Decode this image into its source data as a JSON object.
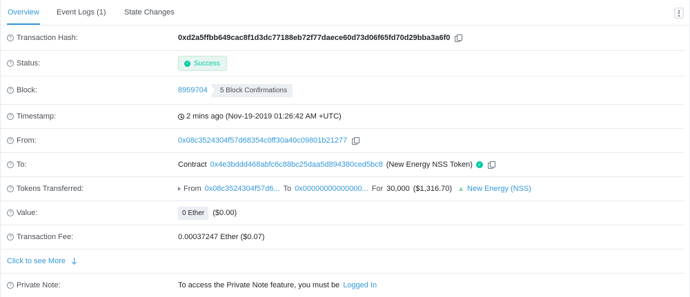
{
  "tabs": [
    {
      "label": "Overview",
      "active": true
    },
    {
      "label": "Event Logs (1)",
      "active": false
    },
    {
      "label": "State Changes",
      "active": false
    }
  ],
  "rows": {
    "tx_hash": {
      "label": "Transaction Hash:",
      "value": "0xd2a5ffbb649cac8f1d3dc77188eb72f77daece60d73d06f65fd70d29bba3a6f0"
    },
    "status": {
      "label": "Status:",
      "value": "Success"
    },
    "block": {
      "label": "Block:",
      "number": "8959704",
      "confirmations": "5 Block Confirmations"
    },
    "timestamp": {
      "label": "Timestamp:",
      "value": "2 mins ago (Nov-19-2019 01:26:42 AM +UTC)"
    },
    "from": {
      "label": "From:",
      "value": "0x08c3524304f57d68354c0ff30a40c09801b21277"
    },
    "to": {
      "label": "To:",
      "prefix": "Contract",
      "address": "0x4e3bddd468abfc6c88bc25daa5d894380ced5bc8",
      "name": "(New Energy NSS Token)"
    },
    "tokens": {
      "label": "Tokens Transferred:",
      "from_label": "From",
      "from_addr": "0x08c3524304f57d6...",
      "to_label": "To",
      "to_addr": "0x00000000000000...",
      "for_label": "For",
      "amount": "30,000",
      "usd": "($1,316.70)",
      "token_name": "New Energy (NSS)"
    },
    "value": {
      "label": "Value:",
      "ether": "0 Ether",
      "usd": "($0.00)"
    },
    "fee": {
      "label": "Transaction Fee:",
      "value": "0.00037247 Ether ($0.07)"
    },
    "more": {
      "label": "Click to see More"
    },
    "note": {
      "label": "Private Note:",
      "text": "To access the Private Note feature, you must be",
      "link": "Logged In"
    }
  },
  "icons": {
    "help": "question-circle",
    "copy": "copy",
    "check": "check-circle",
    "clock": "clock",
    "menu": "vertical-ellipsis",
    "arrow": "arrow-down"
  },
  "colors": {
    "accent": "#3498db",
    "success": "#00c9a7",
    "border": "#e7eaf3"
  }
}
